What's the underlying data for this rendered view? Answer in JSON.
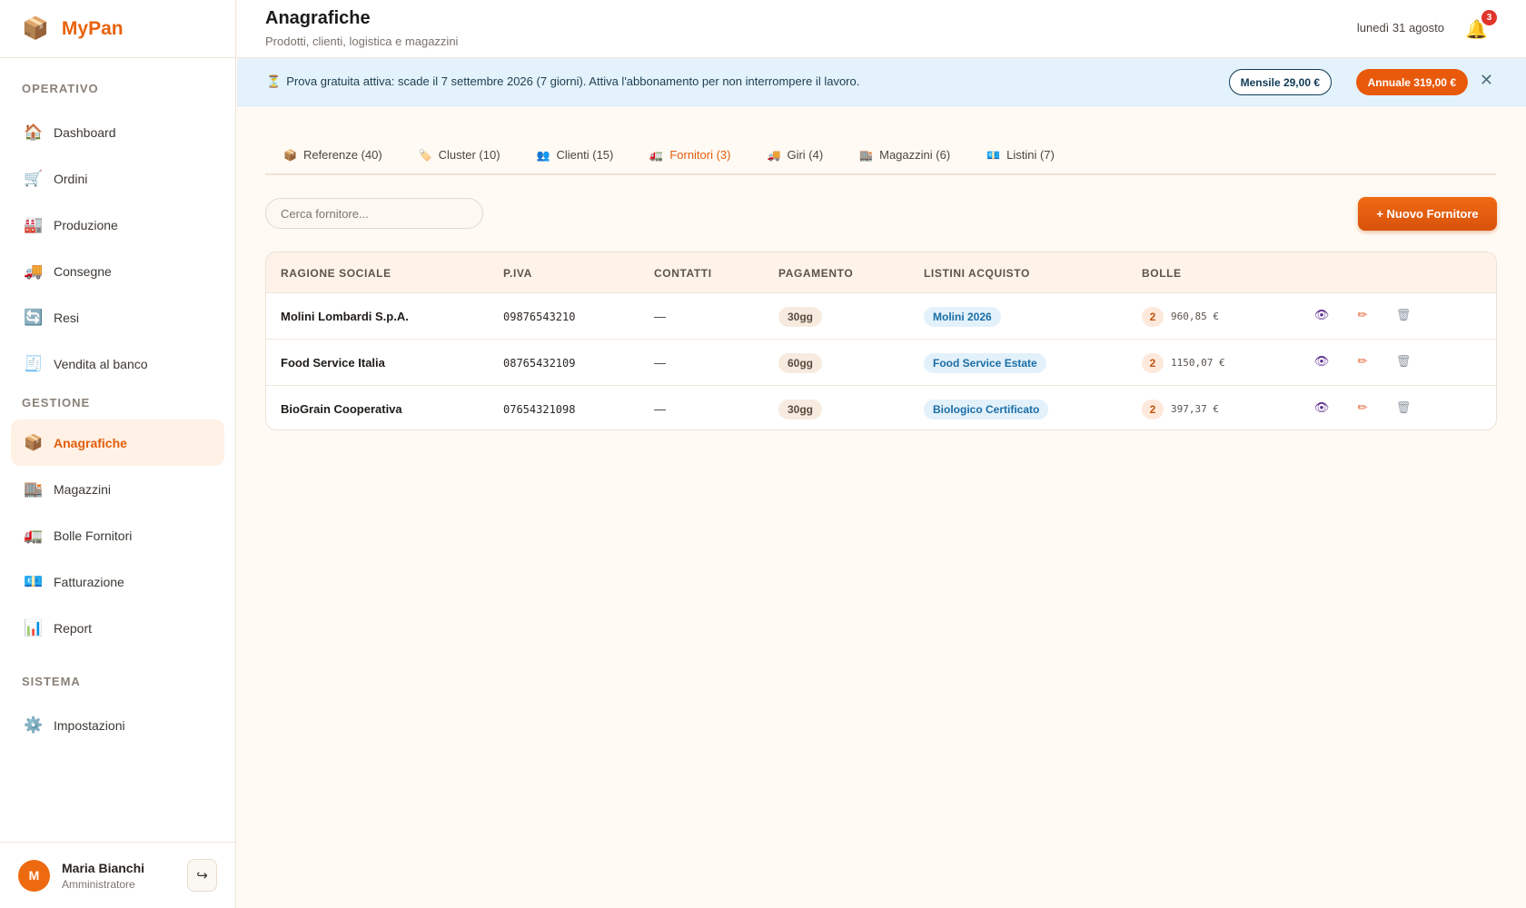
{
  "app": {
    "name": "MyPan",
    "logo_icon": "📦"
  },
  "sidebar": {
    "sections": [
      {
        "label": "OPERATIVO",
        "items": [
          {
            "id": "dashboard",
            "label": "Dashboard",
            "icon": "🏠"
          },
          {
            "id": "ordini",
            "label": "Ordini",
            "icon": "🛒"
          },
          {
            "id": "produzione",
            "label": "Produzione",
            "icon": "🏭"
          },
          {
            "id": "consegne",
            "label": "Consegne",
            "icon": "🚚"
          },
          {
            "id": "resi",
            "label": "Resi",
            "icon": "🔄"
          },
          {
            "id": "vendita",
            "label": "Vendita al banco",
            "icon": "🧾"
          }
        ]
      },
      {
        "label": "GESTIONE",
        "items": [
          {
            "id": "anagrafiche",
            "label": "Anagrafiche",
            "icon": "📦",
            "active": true
          },
          {
            "id": "magazzini",
            "label": "Magazzini",
            "icon": "🏬"
          },
          {
            "id": "bolle",
            "label": "Bolle Fornitori",
            "icon": "🚛"
          },
          {
            "id": "fatturazione",
            "label": "Fatturazione",
            "icon": "💶"
          },
          {
            "id": "report",
            "label": "Report",
            "icon": "📊"
          }
        ]
      },
      {
        "label": "SISTEMA",
        "items": [
          {
            "id": "impostazioni",
            "label": "Impostazioni",
            "icon": "⚙️"
          }
        ]
      }
    ],
    "user": {
      "initial": "M",
      "name": "Maria Bianchi",
      "role": "Amministratore",
      "logout_icon": "↪"
    }
  },
  "header": {
    "title": "Anagrafiche",
    "subtitle": "Prodotti, clienti, logistica e magazzini",
    "date": "lunedì 31 agosto",
    "bell_icon": "🔔",
    "notifications": "3"
  },
  "banner": {
    "icon": "⏳",
    "text": "Prova gratuita attiva: scade il 7 settembre 2026 (7 giorni). Attiva l'abbonamento per non interrompere il lavoro.",
    "monthly_label": "Mensile 29,00 €",
    "annual_label": "Annuale 319,00 €",
    "close_icon": "✕"
  },
  "tabs": [
    {
      "id": "referenze",
      "icon": "📦",
      "label": "Referenze (40)"
    },
    {
      "id": "cluster",
      "icon": "🏷️",
      "label": "Cluster (10)"
    },
    {
      "id": "clienti",
      "icon": "👥",
      "label": "Clienti (15)"
    },
    {
      "id": "fornitori",
      "icon": "🚛",
      "label": "Fornitori (3)",
      "active": true
    },
    {
      "id": "giri",
      "icon": "🚚",
      "label": "Giri (4)"
    },
    {
      "id": "magazzini",
      "icon": "🏬",
      "label": "Magazzini (6)"
    },
    {
      "id": "listini",
      "icon": "💶",
      "label": "Listini (7)"
    }
  ],
  "toolbar": {
    "search_placeholder": "Cerca fornitore...",
    "new_label": "+ Nuovo Fornitore"
  },
  "table": {
    "headers": {
      "name": "RAGIONE SOCIALE",
      "piva": "P.IVA",
      "contatti": "CONTATTI",
      "pagamento": "PAGAMENTO",
      "listini": "LISTINI ACQUISTO",
      "bolle": "BOLLE"
    },
    "rows": [
      {
        "name": "Molini Lombardi S.p.A.",
        "piva": "09876543210",
        "contatti": "—",
        "pagamento": "30gg",
        "listino": "Molini 2026",
        "bolle_count": "2",
        "bolle_amount": "960,85 €"
      },
      {
        "name": "Food Service Italia",
        "piva": "08765432109",
        "contatti": "—",
        "pagamento": "60gg",
        "listino": "Food Service Estate",
        "bolle_count": "2",
        "bolle_amount": "1150,07 €"
      },
      {
        "name": "BioGrain Cooperativa",
        "piva": "07654321098",
        "contatti": "—",
        "pagamento": "30gg",
        "listino": "Biologico Certificato",
        "bolle_count": "2",
        "bolle_amount": "397,37 €"
      }
    ],
    "action_icons": {
      "view": "👁",
      "edit": "✏",
      "delete": "🗑"
    }
  }
}
